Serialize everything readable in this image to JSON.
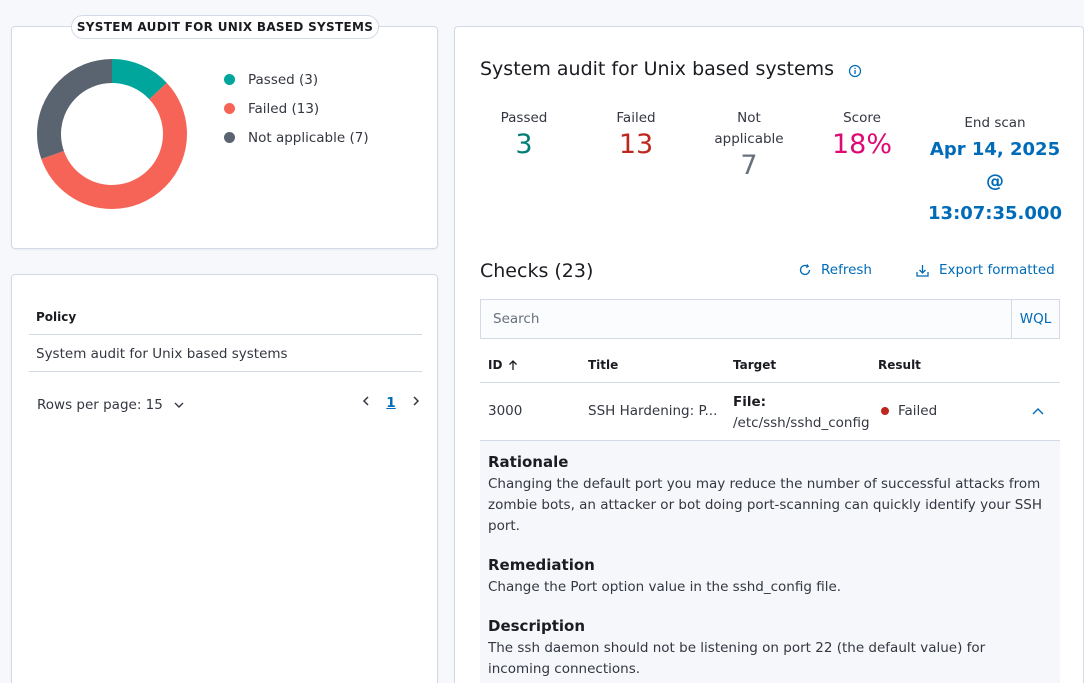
{
  "donut_panel": {
    "title": "SYSTEM AUDIT FOR UNIX BASED SYSTEMS",
    "legend": [
      {
        "label": "Passed (3)",
        "color": "#00a69b",
        "value": 3
      },
      {
        "label": "Failed (13)",
        "color": "#f66458",
        "value": 13
      },
      {
        "label": "Not applicable (7)",
        "color": "#5a6370",
        "value": 7
      }
    ]
  },
  "policy_panel": {
    "column_header": "Policy",
    "row": "System audit for Unix based systems",
    "rows_per_page": "Rows per page: 15",
    "current_page": "1"
  },
  "main": {
    "title": "System audit for Unix based systems",
    "stats": {
      "passed_label": "Passed",
      "passed_value": "3",
      "failed_label": "Failed",
      "failed_value": "13",
      "na_label": "Not applicable",
      "na_value": "7",
      "score_label": "Score",
      "score_value": "18%",
      "end_scan_label": "End scan",
      "end_scan_value": "Apr 14, 2025 @ 13:07:35.000"
    },
    "checks_title": "Checks (23)",
    "refresh_label": "Refresh",
    "export_label": "Export formatted",
    "search_placeholder": "Search",
    "wql_label": "WQL",
    "columns": {
      "id": "ID",
      "title": "Title",
      "target": "Target",
      "result": "Result"
    },
    "row": {
      "id": "3000",
      "title": "SSH Hardening: P...",
      "target_label": "File:",
      "target_value": "/etc/ssh/sshd_config",
      "result": "Failed"
    },
    "details": {
      "rationale_title": "Rationale",
      "rationale_text": "Changing the default port you may reduce the number of successful attacks from zombie bots, an attacker or bot doing port-scanning can quickly identify your SSH port.",
      "remediation_title": "Remediation",
      "remediation_text": "Change the Port option value in the sshd_config file.",
      "description_title": "Description",
      "description_text": "The ssh daemon should not be listening on port 22 (the default value) for incoming connections."
    }
  },
  "colors": {
    "passed": "#00a69b",
    "failed": "#f66458",
    "not_applicable": "#5a6370",
    "score": "#dd0a73",
    "link": "#006bb8",
    "failed_text": "#bd271e",
    "passed_text": "#017d73"
  }
}
